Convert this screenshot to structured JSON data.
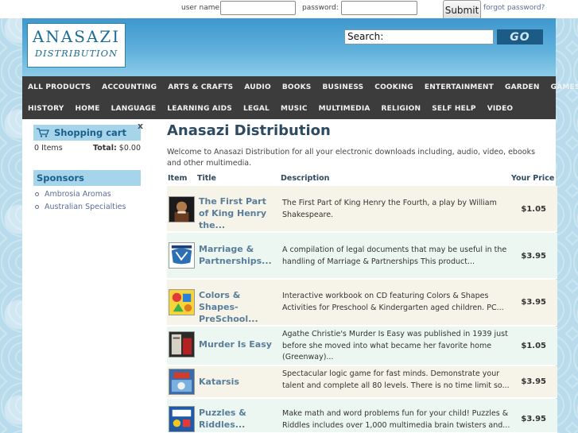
{
  "login": {
    "username_label": "user name:",
    "password_label": "password:",
    "submit_label": "Submit",
    "forgot_label": "forgot password?"
  },
  "header": {
    "logo_top": "ANASAZI",
    "logo_bottom": "DISTRIBUTION",
    "search_value": "Search:",
    "go_label": "GO"
  },
  "nav": {
    "row1": [
      "ALL PRODUCTS",
      "ACCOUNTING",
      "ARTS & CRAFTS",
      "AUDIO",
      "BOOKS",
      "BUSINESS",
      "COOKING",
      "ENTERTAINMENT",
      "GARDEN",
      "GAMES"
    ],
    "row2": [
      "HISTORY",
      "HOME",
      "LANGUAGE",
      "LEARNING AIDS",
      "LEGAL",
      "MUSIC",
      "MULTIMEDIA",
      "RELIGION",
      "SELF HELP",
      "VIDEO"
    ]
  },
  "sidebar": {
    "cart_title": "Shopping cart",
    "close": "x",
    "cart_items": "0 Items",
    "cart_total_label": "Total:",
    "cart_total_value": "$0.00",
    "sponsors_title": "Sponsors",
    "sponsors": [
      "Ambrosia Aromas",
      "Australian Specialties"
    ]
  },
  "main": {
    "title": "Anasazi Distribution",
    "intro": "Welcome to Anasazi Distribution for all your electronic downloads including, audio, video, ebooks and other multimedia.",
    "columns": {
      "item": "Item",
      "title": "Title",
      "description": "Description",
      "price": "Your Price"
    },
    "products": [
      {
        "title": "The First Part of King Henry the...",
        "description": "The First Part of King Henry the Fourth, a play by William Shakespeare.",
        "price": "$1.05"
      },
      {
        "title": "Marriage & Partnerships...",
        "description": "A compilation of legal documents that may be useful in the handling of Marriage & Partnerships   This product...",
        "price": "$3.95"
      },
      {
        "title": "Colors & Shapes-PreSchool...",
        "description": "Interactive workbook on CD featuring Colors & Shapes Activities for Preschool & Kindergarten aged children. PC...",
        "price": "$3.95"
      },
      {
        "title": "Murder Is Easy",
        "description": "Agathe Christie's Murder Is Easy was published in 1939 just before she moved into what became her favorite home (Greenway)...",
        "price": "$1.05"
      },
      {
        "title": "Katarsis",
        "description": "Spectacular logic game for fast minds.  Demonstrate your talent and complete all 80 levels. There is no time limit so...",
        "price": "$3.95"
      },
      {
        "title": "Puzzles & Riddles...",
        "description": "Make math and word problems fun for your child! Puzzles & Riddles includes over 1,000 multimedia brain twisters and...",
        "price": "$3.95"
      }
    ]
  },
  "colors": {
    "nav_bg": "#3c3c3c",
    "header_blue": "#3f97cd",
    "sidebar_head": "#a6d4ea",
    "title_color": "#2e4a60",
    "link_color": "#5a7e9a"
  }
}
